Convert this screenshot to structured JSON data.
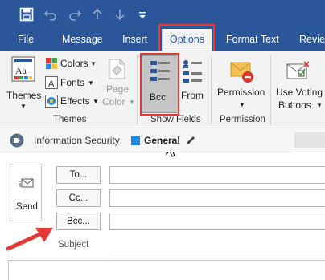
{
  "quick_access": {
    "icons": [
      "save-icon",
      "undo-icon",
      "redo-icon",
      "up-arrow-icon",
      "down-arrow-icon",
      "customize-dropdown-icon"
    ]
  },
  "tabs": [
    {
      "label": "File"
    },
    {
      "label": "Message"
    },
    {
      "label": "Insert"
    },
    {
      "label": "Options",
      "active": true
    },
    {
      "label": "Format Text"
    },
    {
      "label": "Review"
    }
  ],
  "ribbon": {
    "themes_group": {
      "themes_label": "Themes",
      "colors_label": "Colors",
      "fonts_label": "Fonts",
      "effects_label": "Effects",
      "page_color_line1": "Page",
      "page_color_line2": "Color",
      "group_label": "Themes"
    },
    "show_fields_group": {
      "bcc_label": "Bcc",
      "from_label": "From",
      "group_label": "Show Fields"
    },
    "permission_group": {
      "permission_label": "Permission",
      "group_label": "Permission"
    },
    "voting_group": {
      "line1": "Use Voting",
      "line2": "Buttons"
    }
  },
  "info_bar": {
    "label": "Information Security:",
    "value": "General",
    "value_color": "#1e88e5"
  },
  "compose": {
    "send_label": "Send",
    "to_label": "To...",
    "cc_label": "Cc...",
    "bcc_label": "Bcc...",
    "subject_label": "Subject"
  },
  "colors": {
    "accent": "#2b579a",
    "callout": "#e53935"
  }
}
